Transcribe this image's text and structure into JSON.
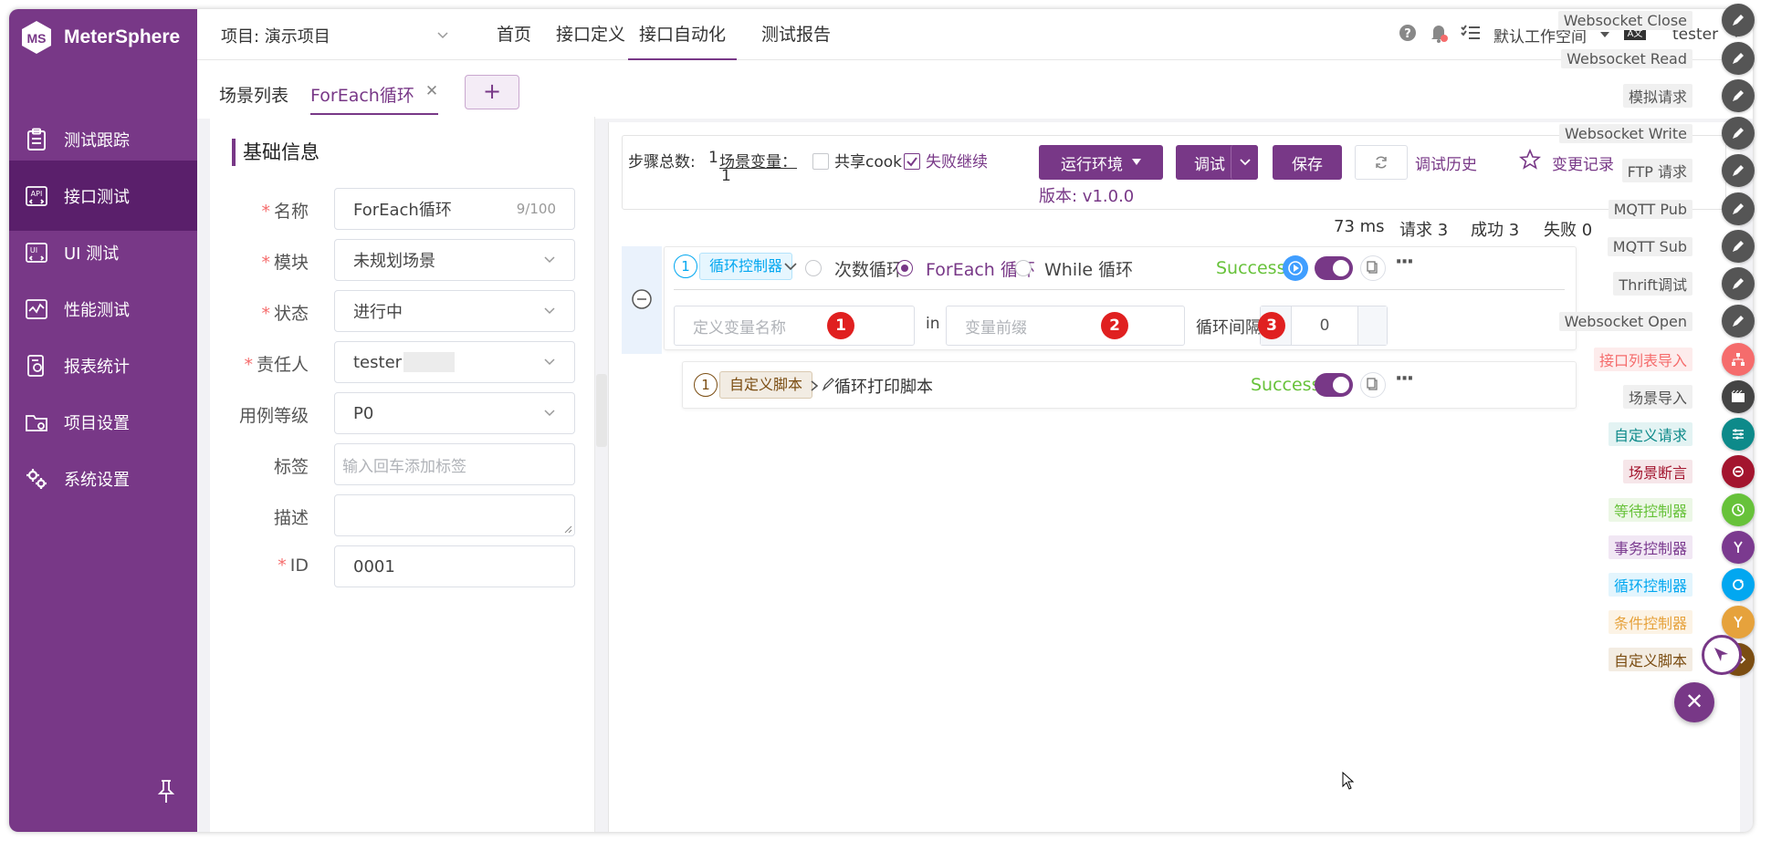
{
  "brand": {
    "name": "MeterSphere"
  },
  "sidebar": {
    "items": [
      {
        "label": "测试跟踪",
        "icon": "clipboard-icon"
      },
      {
        "label": "接口测试",
        "icon": "api-icon",
        "active": true
      },
      {
        "label": "UI 测试",
        "icon": "ui-icon"
      },
      {
        "label": "性能测试",
        "icon": "performance-icon"
      },
      {
        "label": "报表统计",
        "icon": "report-icon"
      },
      {
        "label": "项目设置",
        "icon": "folder-settings-icon"
      },
      {
        "label": "系统设置",
        "icon": "gears-icon"
      }
    ]
  },
  "header": {
    "project": "项目: 演示项目",
    "tabs": [
      "首页",
      "接口定义",
      "接口自动化",
      "测试报告"
    ],
    "workspace": "默认工作空间",
    "user": "tester"
  },
  "subtabs": {
    "list": "场景列表",
    "current": "ForEach循环",
    "add": "+"
  },
  "form": {
    "title": "基础信息",
    "name_label": "名称",
    "name_value": "ForEach循环",
    "name_count": "9/100",
    "module_label": "模块",
    "module_value": "未规划场景",
    "status_label": "状态",
    "status_value": "进行中",
    "owner_label": "责任人",
    "owner_value": "tester",
    "level_label": "用例等级",
    "level_value": "P0",
    "tag_label": "标签",
    "tag_placeholder": "输入回车添加标签",
    "desc_label": "描述",
    "id_label": "ID",
    "id_value": "0001"
  },
  "toolbar": {
    "steps_label": "步骤总数:",
    "steps_value": "1",
    "scene_var": "场景变量：",
    "scene_var_value": "1",
    "share_cookie": "共享cook",
    "continue_on_fail": "失败继续",
    "env_btn": "运行环境",
    "debug_btn": "调试",
    "save_btn": "保存",
    "history": "调试历史",
    "changelog": "变更记录",
    "version": "版本: v1.0.0"
  },
  "stats": {
    "time": "73 ms",
    "requests": "请求 3",
    "success": "成功 3",
    "fail": "失败 0"
  },
  "step1": {
    "num": "1",
    "tag": "循环控制器",
    "opt1": "次数循环",
    "opt2": "ForEach 循环",
    "opt3": "While 循环",
    "status": "Success",
    "var_placeholder": "定义变量名称",
    "in_label": "in",
    "prefix_placeholder": "变量前缀",
    "interval_label": "循环间隔",
    "interval_value": "0",
    "badge1": "1",
    "badge2": "2",
    "badge3": "3"
  },
  "step2": {
    "num": "1",
    "tag": "自定义脚本",
    "name": "循环打印脚本",
    "status": "Success"
  },
  "right_menu": [
    {
      "label": "Websocket Close",
      "color": "#444"
    },
    {
      "label": "Websocket Read",
      "color": "#444"
    },
    {
      "label": "模拟请求",
      "color": "#444"
    },
    {
      "label": "Websocket Write",
      "color": "#444"
    },
    {
      "label": "FTP 请求",
      "color": "#444"
    },
    {
      "label": "MQTT Pub",
      "color": "#444"
    },
    {
      "label": "MQTT Sub",
      "color": "#444"
    },
    {
      "label": "Thrift调试",
      "color": "#444"
    },
    {
      "label": "Websocket Open",
      "color": "#444"
    },
    {
      "label": "接口列表导入",
      "color": "#f56c6c"
    },
    {
      "label": "场景导入",
      "color": "#444"
    },
    {
      "label": "自定义请求",
      "color": "#0d8a8a"
    },
    {
      "label": "场景断言",
      "color": "#a3152e"
    },
    {
      "label": "等待控制器",
      "color": "#67c23a"
    },
    {
      "label": "事务控制器",
      "color": "#7b3a8f"
    },
    {
      "label": "循环控制器",
      "color": "#02a7f0"
    },
    {
      "label": "条件控制器",
      "color": "#e6a23c"
    },
    {
      "label": "自定义脚本",
      "color": "#7b4d12"
    }
  ]
}
